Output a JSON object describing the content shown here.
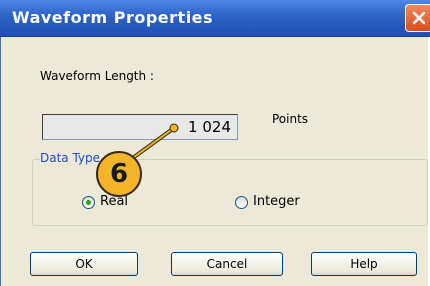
{
  "dialog": {
    "title": "Waveform Properties"
  },
  "waveform_length": {
    "label": "Waveform Length :",
    "value": "1 024",
    "unit": "Points"
  },
  "data_type": {
    "group_label": "Data Type",
    "options": [
      {
        "label": "Real",
        "selected": true
      },
      {
        "label": "Integer",
        "selected": false
      }
    ]
  },
  "buttons": {
    "ok": "OK",
    "cancel": "Cancel",
    "help": "Help"
  },
  "callout": {
    "number": "6",
    "color": "#f5b52a"
  },
  "colors": {
    "titlebar": "#2f64c9",
    "close": "#d84e1c",
    "group_title": "#1e4fd0"
  }
}
